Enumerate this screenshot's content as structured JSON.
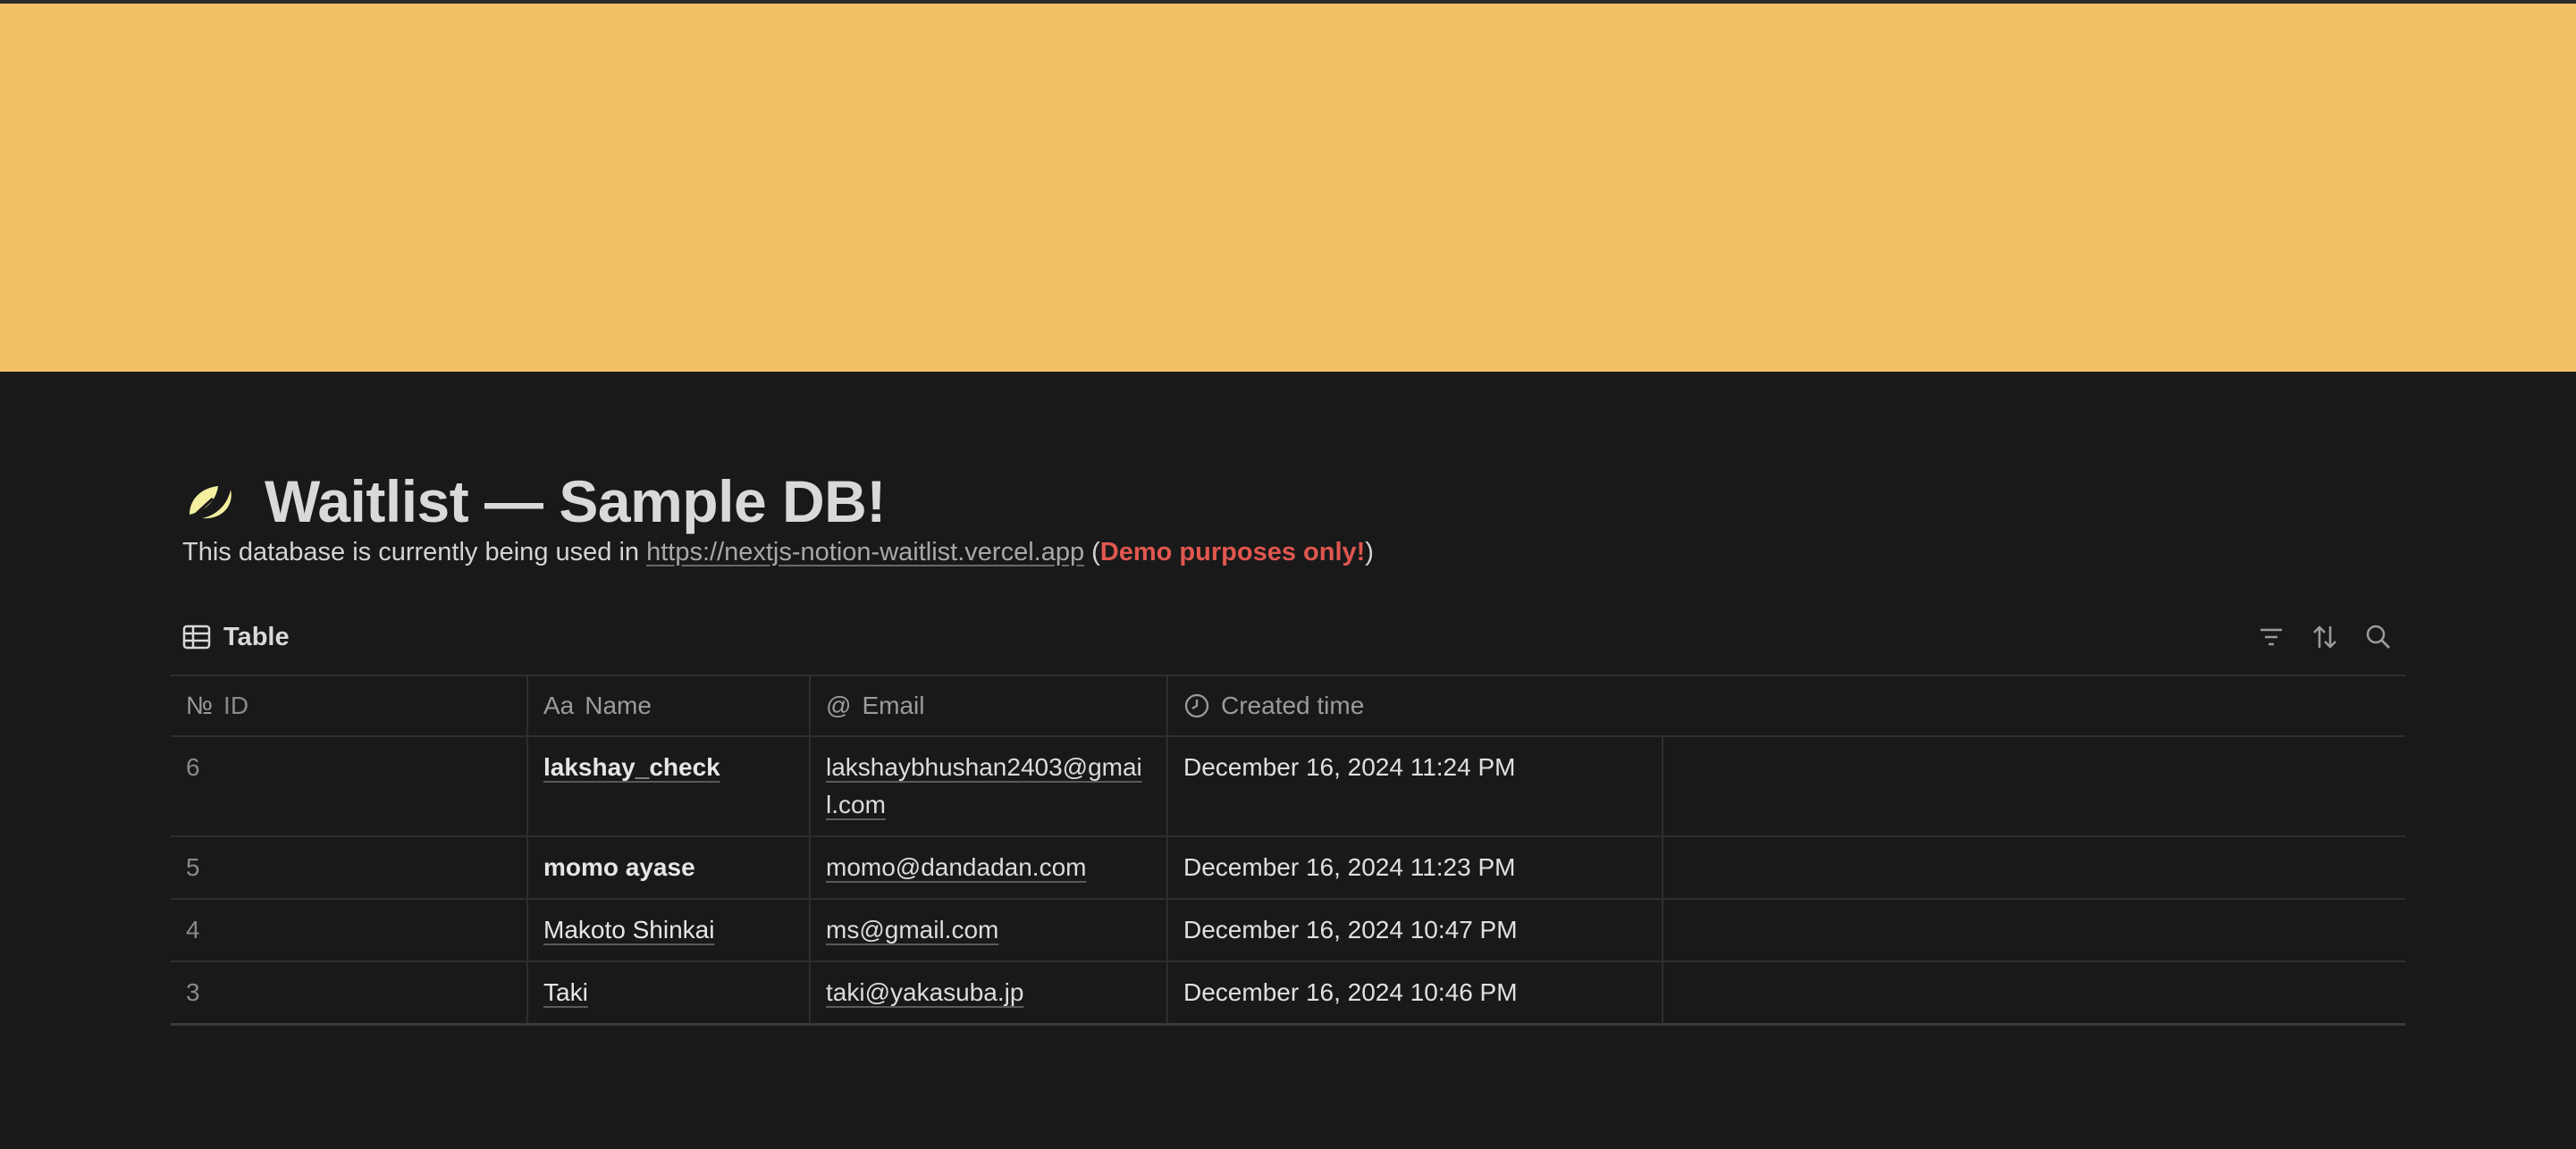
{
  "cover": {
    "color": "#f2c166"
  },
  "page": {
    "icon": "leaf-icon",
    "title": "Waitlist — Sample DB!",
    "description": {
      "prefix": "This database is currently being used in ",
      "link": "https://nextjs-notion-waitlist.vercel.app",
      "open_paren": " (",
      "highlight": "Demo purposes only!",
      "close_paren": ")"
    }
  },
  "view": {
    "tab_label": "Table",
    "actions": [
      "filter-icon",
      "sort-icon",
      "search-icon"
    ]
  },
  "table": {
    "columns": [
      {
        "icon": "№",
        "label": "ID"
      },
      {
        "icon": "Aa",
        "label": "Name"
      },
      {
        "icon": "@",
        "label": "Email"
      },
      {
        "icon": "clock-icon",
        "label": "Created time"
      }
    ],
    "rows": [
      {
        "id": "6",
        "name": "lakshay_check",
        "email": "lakshaybhushan2403@gmail.com",
        "created": "December 16, 2024 11:24 PM"
      },
      {
        "id": "5",
        "name": "momo ayase",
        "email": "momo@dandadan.com",
        "created": "December 16, 2024 11:23 PM"
      },
      {
        "id": "4",
        "name": "Makoto Shinkai",
        "email": "ms@gmail.com",
        "created": "December 16, 2024 10:47 PM"
      },
      {
        "id": "3",
        "name": "Taki",
        "email": "taki@yakasuba.jp",
        "created": "December 16, 2024 10:46 PM"
      }
    ]
  }
}
